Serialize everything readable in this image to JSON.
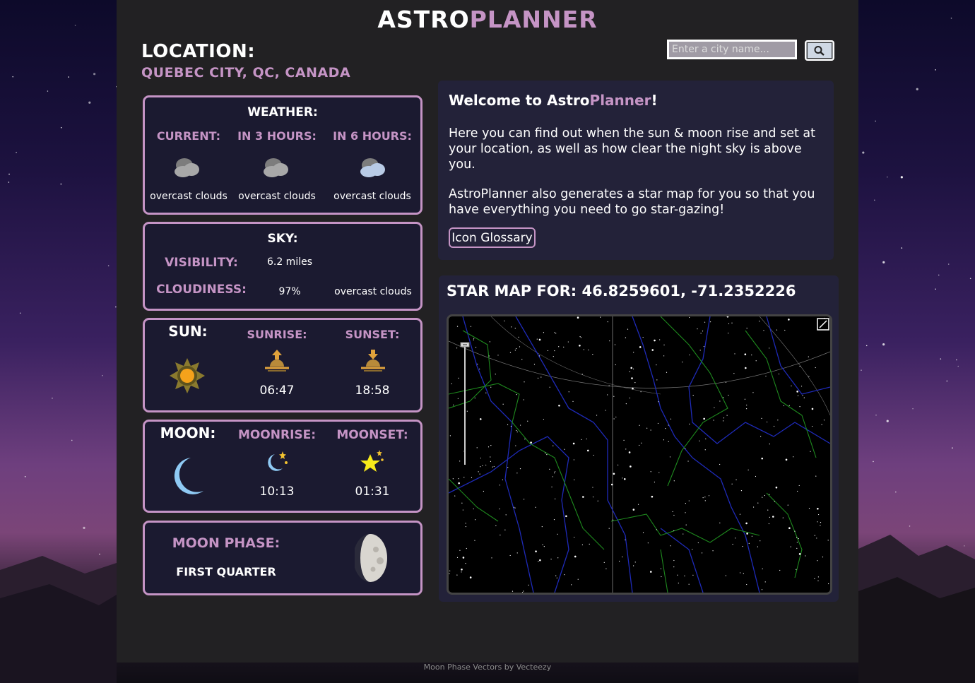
{
  "app": {
    "title_part1": "ASTRO",
    "title_part2": "PLANNER"
  },
  "location": {
    "heading": "LOCATION:",
    "city": "QUEBEC CITY, QC, CANADA"
  },
  "search": {
    "placeholder": "Enter a city name...",
    "icon": "search-icon"
  },
  "weather": {
    "heading": "WEATHER:",
    "columns": [
      {
        "label": "CURRENT:",
        "desc": "overcast clouds",
        "icon": "cloud-icon"
      },
      {
        "label": "IN 3 HOURS:",
        "desc": "overcast clouds",
        "icon": "cloud-icon"
      },
      {
        "label": "IN 6 HOURS:",
        "desc": "overcast clouds",
        "icon": "cloud-icon"
      }
    ]
  },
  "sky": {
    "heading": "SKY:",
    "visibility_label": "VISIBILITY:",
    "visibility_value": "6.2 miles",
    "cloudiness_label": "CLOUDINESS:",
    "cloudiness_value": "97%",
    "cloudiness_desc": "overcast clouds"
  },
  "sun": {
    "heading": "SUN:",
    "sunrise_label": "SUNRISE:",
    "sunrise_time": "06:47",
    "sunset_label": "SUNSET:",
    "sunset_time": "18:58"
  },
  "moon": {
    "heading": "MOON:",
    "moonrise_label": "MOONRISE:",
    "moonrise_time": "10:13",
    "moonset_label": "MOONSET:",
    "moonset_time": "01:31"
  },
  "moon_phase": {
    "label": "MOON PHASE:",
    "value": "FIRST QUARTER"
  },
  "welcome": {
    "heading_part1": "Welcome to Astro",
    "heading_part2": "Planner",
    "heading_part3": "!",
    "para1": "Here you can find out when the sun & moon rise and set at your location, as well as how clear the night sky is above you.",
    "para2": "AstroPlanner also generates a star map for you so that you have everything you need to go star-gazing!",
    "glossary_button": "Icon Glossary"
  },
  "starmap": {
    "heading": "STAR MAP FOR: 46.8259601, -71.2352226"
  },
  "footer": {
    "credit": "Moon Phase Vectors by Vecteezy"
  },
  "colors": {
    "accent": "#c594c5",
    "card_bg": "#1b1a30",
    "panel_bg": "#222123"
  }
}
